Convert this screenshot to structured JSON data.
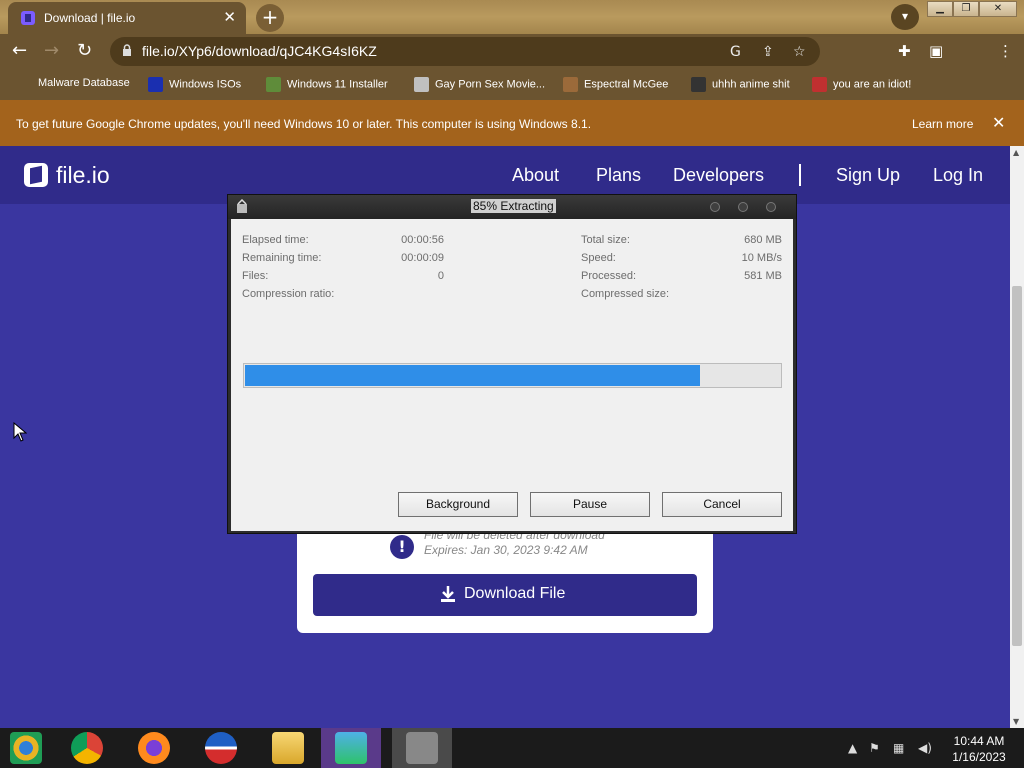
{
  "browser": {
    "tab_title": "Download | file.io",
    "tab_close": "✕",
    "new_tab": "+",
    "url": "file.io/XYp6/download/qJC4KG4sI6KZ",
    "bookmarks": [
      {
        "label": "Malware Database",
        "icon_color": "#6b5430"
      },
      {
        "label": "Windows ISOs",
        "icon_color": "#1a2fb0"
      },
      {
        "label": "Windows 11 Installer",
        "icon_color": "#5f8c3a"
      },
      {
        "label": "Gay Porn Sex Movie...",
        "icon_color": "#c0c0c0"
      },
      {
        "label": "Espectral McGee",
        "icon_color": "#9b6a3a"
      },
      {
        "label": "uhhh anime shit",
        "icon_color": "#333333"
      },
      {
        "label": "you are an idiot!",
        "icon_color": "#c03030"
      }
    ],
    "infobar": {
      "message": "To get future Google Chrome updates, you'll need Windows 10 or later. This computer is using Windows 8.1.",
      "learn_more": "Learn more",
      "close": "✕"
    }
  },
  "site": {
    "logo_text": "file.io",
    "nav": [
      "About",
      "Plans",
      "Developers",
      "Sign Up",
      "Log In"
    ],
    "card": {
      "deleted_text": "File will be deleted after download",
      "expires_text": "Expires: Jan 30, 2023 9:42 AM",
      "download_label": "Download File"
    }
  },
  "dialog": {
    "title": "85% Extracting",
    "progress_fraction": 0.85,
    "left_stats": [
      {
        "label": "Elapsed time:",
        "value": "00:00:56"
      },
      {
        "label": "Remaining time:",
        "value": "00:00:09"
      },
      {
        "label": "Files:",
        "value": "0"
      },
      {
        "label": "Compression ratio:",
        "value": ""
      }
    ],
    "right_stats": [
      {
        "label": "Total size:",
        "value": "680 MB"
      },
      {
        "label": "Speed:",
        "value": "10 MB/s"
      },
      {
        "label": "Processed:",
        "value": "581 MB"
      },
      {
        "label": "Compressed size:",
        "value": ""
      }
    ],
    "buttons": {
      "background": "Background",
      "pause": "Pause",
      "cancel": "Cancel"
    }
  },
  "taskbar": {
    "time": "10:44 AM",
    "date": "1/16/2023",
    "apps": [
      "chrome-canary-icon",
      "chrome-icon",
      "firefox-icon",
      "obama-logo-icon",
      "file-explorer-icon",
      "people-icon",
      "7zip-icon"
    ]
  },
  "colors": {
    "accent": "#302b8a",
    "progress": "#2f8ee8",
    "infobar": "#a3631c"
  }
}
